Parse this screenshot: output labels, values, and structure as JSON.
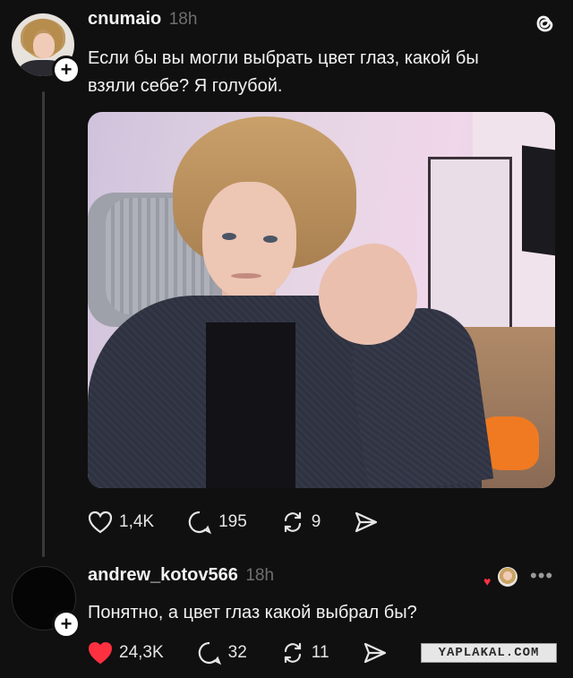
{
  "post": {
    "username": "cnumaio",
    "time": "18h",
    "text_line1": "Если бы вы могли выбрать цвет глаз, какой бы",
    "text_line2": "взяли себе? Я голубой.",
    "likes": "1,4K",
    "comments": "195",
    "reposts": "9"
  },
  "reply": {
    "username": "andrew_kotov566",
    "time": "18h",
    "text": "Понятно, а цвет глаз какой выбрал бы?",
    "likes": "24,3K",
    "comments": "32",
    "reposts": "11",
    "liked": true
  },
  "follow_plus": "+",
  "watermark": "YAPLAKAL.COM",
  "colors": {
    "like_red": "#ff3040",
    "background": "#101010"
  }
}
